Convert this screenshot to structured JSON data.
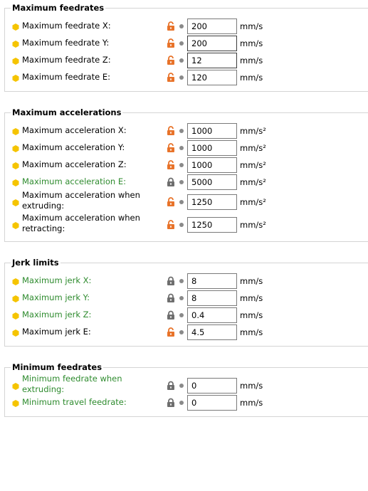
{
  "groups": [
    {
      "title": "Maximum feedrates",
      "rows": [
        {
          "label": "Maximum feedrate X:",
          "value": "200",
          "unit": "mm/s",
          "lock": "open",
          "sys": false
        },
        {
          "label": "Maximum feedrate Y:",
          "value": "200",
          "unit": "mm/s",
          "lock": "open",
          "sys": false
        },
        {
          "label": "Maximum feedrate Z:",
          "value": "12",
          "unit": "mm/s",
          "lock": "open",
          "sys": false
        },
        {
          "label": "Maximum feedrate E:",
          "value": "120",
          "unit": "mm/s",
          "lock": "open",
          "sys": false
        }
      ]
    },
    {
      "title": "Maximum accelerations",
      "rows": [
        {
          "label": "Maximum acceleration X:",
          "value": "1000",
          "unit": "mm/s²",
          "lock": "open",
          "sys": false
        },
        {
          "label": "Maximum acceleration Y:",
          "value": "1000",
          "unit": "mm/s²",
          "lock": "open",
          "sys": false
        },
        {
          "label": "Maximum acceleration Z:",
          "value": "1000",
          "unit": "mm/s²",
          "lock": "open",
          "sys": false
        },
        {
          "label": "Maximum acceleration E:",
          "value": "5000",
          "unit": "mm/s²",
          "lock": "closed",
          "sys": true
        },
        {
          "label": "Maximum acceleration when extruding:",
          "value": "1250",
          "unit": "mm/s²",
          "lock": "open",
          "sys": false
        },
        {
          "label": "Maximum acceleration when retracting:",
          "value": "1250",
          "unit": "mm/s²",
          "lock": "open",
          "sys": false
        }
      ]
    },
    {
      "title": "Jerk limits",
      "rows": [
        {
          "label": "Maximum jerk X:",
          "value": "8",
          "unit": "mm/s",
          "lock": "closed",
          "sys": true
        },
        {
          "label": "Maximum jerk Y:",
          "value": "8",
          "unit": "mm/s",
          "lock": "closed",
          "sys": true
        },
        {
          "label": "Maximum jerk Z:",
          "value": "0.4",
          "unit": "mm/s",
          "lock": "closed",
          "sys": true
        },
        {
          "label": "Maximum jerk E:",
          "value": "4.5",
          "unit": "mm/s",
          "lock": "open",
          "sys": false
        }
      ]
    },
    {
      "title": "Minimum feedrates",
      "rows": [
        {
          "label": "Minimum feedrate when extruding:",
          "value": "0",
          "unit": "mm/s",
          "lock": "closed",
          "sys": true
        },
        {
          "label": "Minimum travel feedrate:",
          "value": "0",
          "unit": "mm/s",
          "lock": "closed",
          "sys": true
        }
      ]
    }
  ],
  "colors": {
    "system_label": "#2e8b2e",
    "unlocked_icon": "#e8732a",
    "locked_icon": "#6e6e6e",
    "mode_hex": "#f5c400"
  },
  "icons": {
    "mode": "yellow-hexagon-icon",
    "unlocked": "unlocked-padlock-icon",
    "locked": "locked-padlock-icon",
    "bullet": "dot-icon"
  }
}
